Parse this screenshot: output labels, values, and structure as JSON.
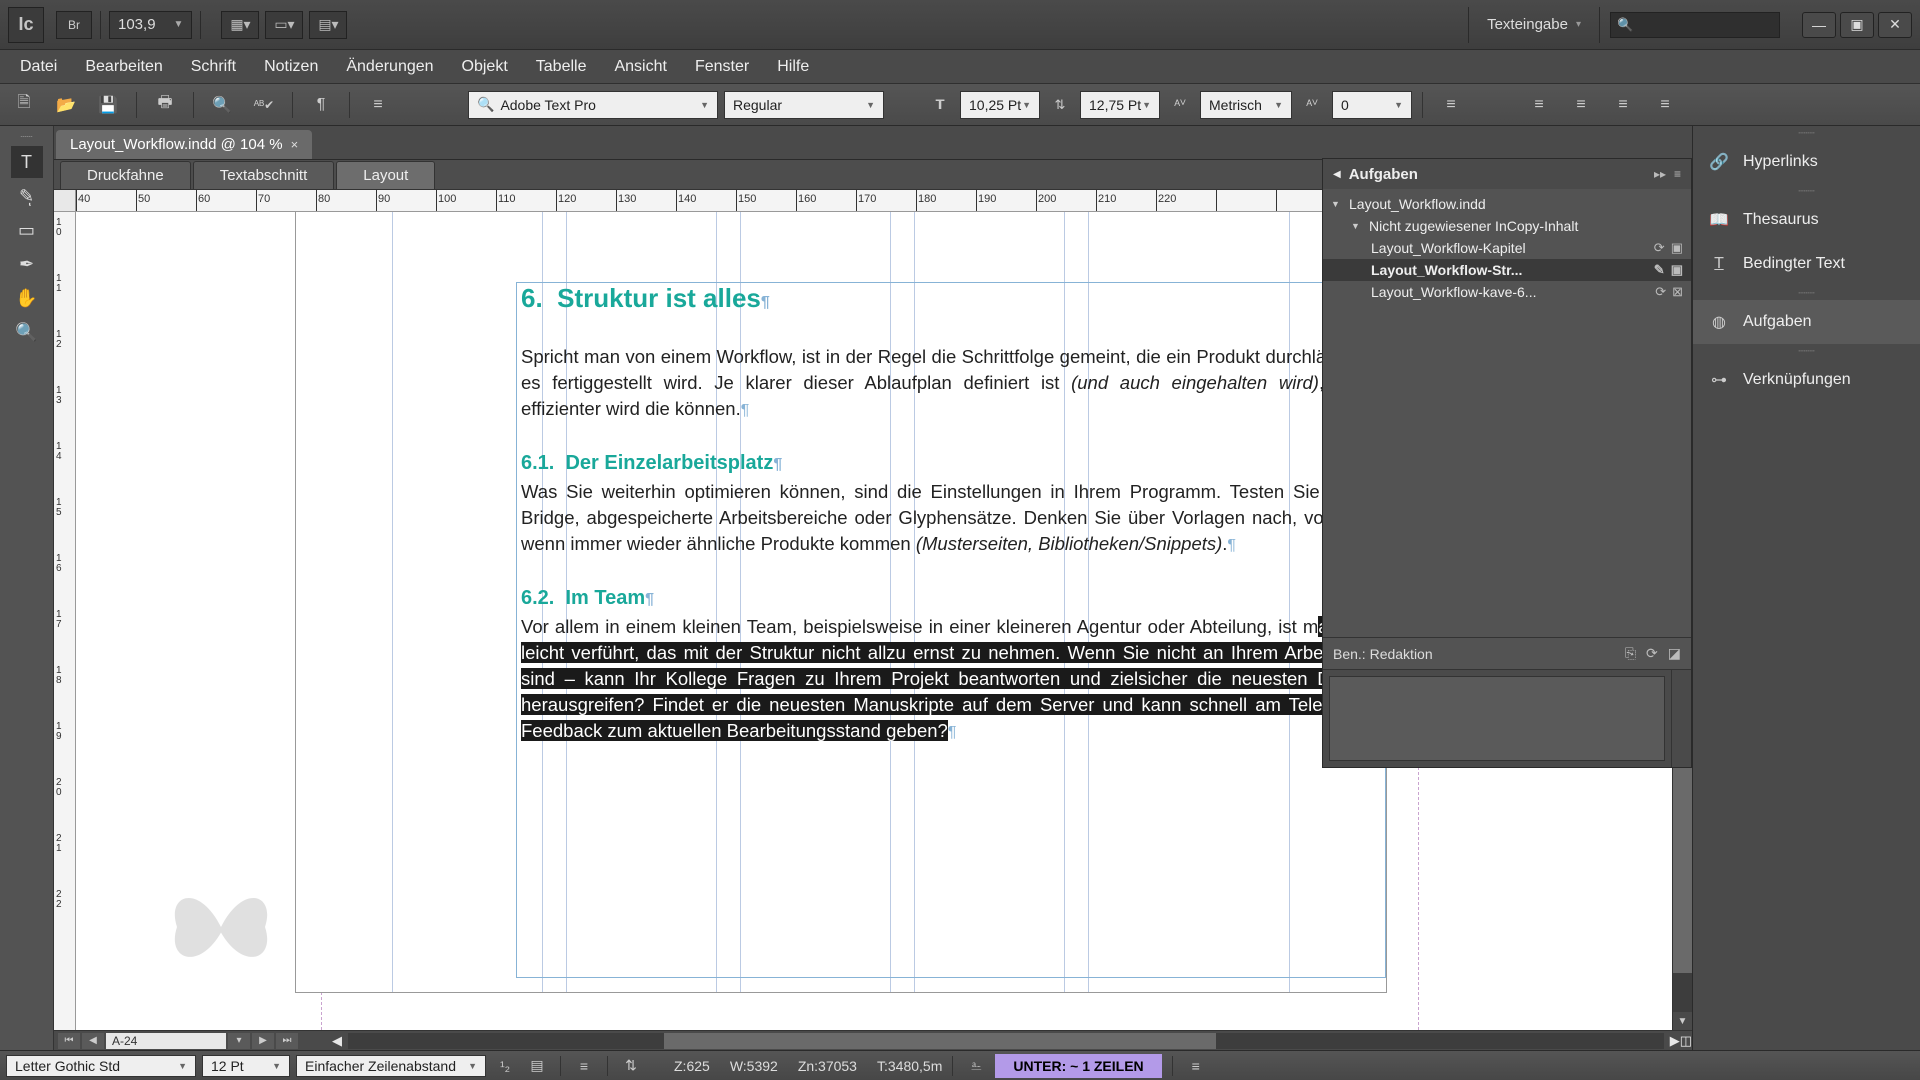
{
  "titlebar": {
    "logo": "Ic",
    "bridge": "Br",
    "zoom": "103,9",
    "workspace": "Texteingabe",
    "search_placeholder": ""
  },
  "menu": [
    "Datei",
    "Bearbeiten",
    "Schrift",
    "Notizen",
    "Änderungen",
    "Objekt",
    "Tabelle",
    "Ansicht",
    "Fenster",
    "Hilfe"
  ],
  "controlbar": {
    "font": "Adobe Text Pro",
    "style": "Regular",
    "size": "10,25 Pt",
    "leading": "12,75 Pt",
    "kerning": "Metrisch",
    "tracking": "0"
  },
  "doc": {
    "tab": "Layout_Workflow.indd @ 104 %",
    "viewtabs": [
      "Druckfahne",
      "Textabschnitt",
      "Layout"
    ],
    "active_viewtab": 2,
    "page_nav": "A-24"
  },
  "content": {
    "h1_num": "6.",
    "h1": "Struktur ist alles",
    "p1a": "Spricht man von einem Workflow, ist in der Regel die Schrittfolge gemeint, die ein Produkt durchläuft, bis es fertiggestellt wird. Je klarer dieser Ab­laufplan definiert ist ",
    "p1it": "(und auch eingehalten wird)",
    "p1b": ", umso effizienter wird die können.",
    "h2a_num": "6.1.",
    "h2a": "Der Einzelarbeitsplatz",
    "p2a": "Was Sie weiterhin optimieren können, sind die Einstellungen in Ihrem Programm. Testen Sie Adobe Bridge, abgespeicherte Arbeitsbereiche oder Glyphensätze. Denken Sie über Vorlagen nach, vor allem wenn immer wie­der ähnliche Produkte kommen ",
    "p2it": "(Musterseiten, Bibliotheken/Snippets)",
    "p2b": ".",
    "h2b_num": "6.2.",
    "h2b": "Im Team",
    "p3_pre": "Vor allem in einem kleinen Team, beispielsweise in einer kleineren Agentur oder Abteilung, ist m",
    "p3_sel": "an sehr leicht verführt, das mit der Struktur nicht allzu ernst zu nehmen. Wenn Sie nicht an Ihrem Arbeitsplatz sind – kann Ihr Kollege Fragen zu Ihrem Projekt beantworten und zielsicher die neuesten Dateien herausgreifen? Findet er die neuesten Manuskripte auf dem Server und kann schnell am Telefon ein Feedback zum aktuellen Bearbeitungs­stand geben?"
  },
  "aufgaben": {
    "title": "Aufgaben",
    "root": "Layout_Workflow.indd",
    "group": "Nicht zugewiesener InCopy-Inhalt",
    "items": [
      "Layout_Workflow-Kapitel",
      "Layout_Workflow-Str...",
      "Layout_Workflow-kave-6..."
    ],
    "selected": 1,
    "user_label": "Ben.: Redaktion"
  },
  "right_panels": [
    "Hyperlinks",
    "Thesaurus",
    "Bedingter Text",
    "Aufgaben",
    "Verknüpfungen"
  ],
  "status": {
    "font": "Letter Gothic Std",
    "size": "12 Pt",
    "linespacing": "Einfacher Zeilenabstand",
    "z": "Z:625",
    "w": "W:5392",
    "zn": "Zn:37053",
    "t": "T:3480,5m",
    "badge": "UNTER:  ~ 1 ZEILEN"
  },
  "ruler_h": [
    40,
    50,
    60,
    70,
    80,
    90,
    100,
    110,
    120,
    130,
    140,
    150,
    160,
    170,
    180,
    190,
    200,
    210,
    220
  ],
  "ruler_v": [
    "10",
    "11",
    "12",
    "13",
    "14",
    "15",
    "16",
    "17",
    "18",
    "19",
    "20",
    "21",
    "22"
  ]
}
